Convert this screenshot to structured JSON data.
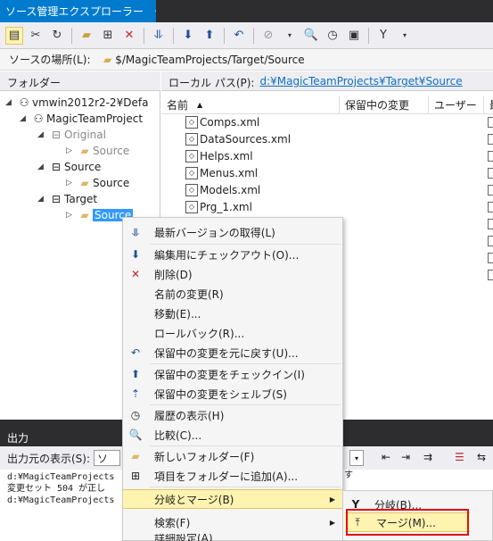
{
  "window": {
    "title": "ソース管理エクスプローラー",
    "pin": "⊣",
    "close": "✕"
  },
  "source_location": {
    "label": "ソースの場所(L):",
    "path": "$/MagicTeamProjects/Target/Source"
  },
  "folders_header": "フォルダー",
  "tree": {
    "server": "vmwin2012r2-2¥Defa",
    "project": "MagicTeamProject",
    "nodes": [
      {
        "label": "Original"
      },
      {
        "label": "Source"
      },
      {
        "label": "Source"
      },
      {
        "label": "Source"
      },
      {
        "label": "Target"
      },
      {
        "label": "Source"
      }
    ]
  },
  "local_path": {
    "label": "ローカル パス(P):",
    "value": "d:¥MagicTeamProjects¥Target¥Source"
  },
  "columns": [
    "名前",
    "保留中の変更",
    "ユーザー",
    "最"
  ],
  "files": [
    "Comps.xml",
    "DataSources.xml",
    "Helps.xml",
    "Menus.xml",
    "Models.xml",
    "Prg_1.xml"
  ],
  "output": {
    "title": "出力",
    "show_from": "出力元の表示(S):",
    "selected": "ソ",
    "lines": [
      "d:¥MagicTeamProjects",
      "変更セット 504 が正し",
      "d:¥MagicTeamProjects"
    ],
    "extra": "す"
  },
  "context_menu": [
    {
      "label": "最新バージョンの取得(L)",
      "icon": "get-latest-icon"
    },
    {
      "label": "編集用にチェックアウト(O)...",
      "icon": "checkout-icon"
    },
    {
      "label": "削除(D)",
      "icon": "delete-icon"
    },
    {
      "label": "名前の変更(R)"
    },
    {
      "label": "移動(E)..."
    },
    {
      "label": "ロールバック(R)..."
    },
    {
      "label": "保留中の変更を元に戻す(U)...",
      "icon": "undo-icon"
    },
    {
      "label": "保留中の変更をチェックイン(I)",
      "icon": "checkin-icon"
    },
    {
      "label": "保留中の変更をシェルブ(S)",
      "icon": "shelve-icon"
    },
    {
      "label": "履歴の表示(H)",
      "icon": "history-icon"
    },
    {
      "label": "比較(C)...",
      "icon": "compare-icon"
    },
    {
      "label": "新しいフォルダー(F)",
      "icon": "new-folder-icon"
    },
    {
      "label": "項目をフォルダーに追加(A)...",
      "icon": "add-items-icon"
    },
    {
      "label": "分岐とマージ(B)"
    },
    {
      "label": "検索(F)"
    },
    {
      "label": "詳細設定(A)"
    }
  ],
  "submenu": [
    {
      "label": "分岐(B)..."
    },
    {
      "label": "マージ(M)..."
    }
  ],
  "colors": {
    "accent": "#007acc",
    "highlight": "#fff3b0",
    "selection": "#3399ff",
    "annotation": "#e01010"
  }
}
